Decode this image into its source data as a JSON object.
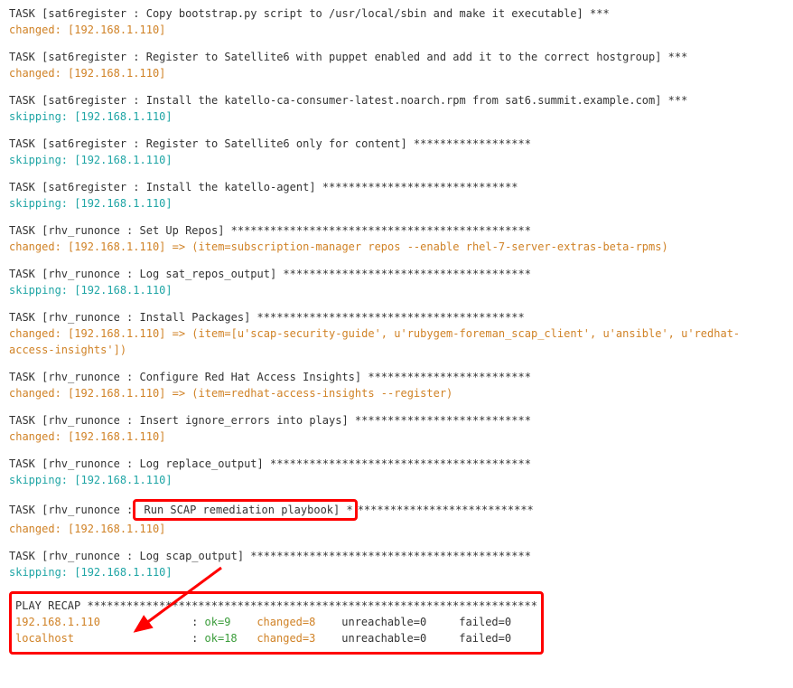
{
  "tasks": [
    {
      "header": "TASK [sat6register : Copy bootstrap.py script to /usr/local/sbin and make it executable] ***",
      "status_class": "changed",
      "status_text": "changed: [192.168.1.110]"
    },
    {
      "header": "TASK [sat6register : Register to Satellite6 with puppet enabled and add it to the correct hostgroup] ***",
      "status_class": "changed",
      "status_text": "changed: [192.168.1.110]"
    },
    {
      "header": "TASK [sat6register : Install the katello-ca-consumer-latest.noarch.rpm from sat6.summit.example.com] ***",
      "status_class": "skipping",
      "status_text": "skipping: [192.168.1.110]"
    },
    {
      "header": "TASK [sat6register : Register to Satellite6 only for content] ******************",
      "status_class": "skipping",
      "status_text": "skipping: [192.168.1.110]"
    },
    {
      "header": "TASK [sat6register : Install the katello-agent] ******************************",
      "status_class": "skipping",
      "status_text": "skipping: [192.168.1.110]"
    },
    {
      "header": "TASK [rhv_runonce : Set Up Repos] **********************************************",
      "status_class": "changed",
      "status_text": "changed: [192.168.1.110] => (item=subscription-manager repos --enable rhel-7-server-extras-beta-rpms)"
    },
    {
      "header": "TASK [rhv_runonce : Log sat_repos_output] **************************************",
      "status_class": "skipping",
      "status_text": "skipping: [192.168.1.110]"
    },
    {
      "header": "TASK [rhv_runonce : Install Packages] *****************************************",
      "status_class": "changed",
      "status_text": "changed: [192.168.1.110] => (item=[u'scap-security-guide', u'rubygem-foreman_scap_client', u'ansible', u'redhat-access-insights'])"
    },
    {
      "header": "TASK [rhv_runonce : Configure Red Hat Access Insights] *************************",
      "status_class": "changed",
      "status_text": "changed: [192.168.1.110] => (item=redhat-access-insights --register)"
    },
    {
      "header": "TASK [rhv_runonce : Insert ignore_errors into plays] ***************************",
      "status_class": "changed",
      "status_text": "changed: [192.168.1.110]"
    },
    {
      "header": "TASK [rhv_runonce : Log replace_output] ****************************************",
      "status_class": "skipping",
      "status_text": "skipping: [192.168.1.110]"
    }
  ],
  "highlighted_task": {
    "header_pre": "TASK [rhv_runonce :",
    "header_boxed": " Run SCAP remediation playbook] *",
    "header_post": "***************************",
    "status_class": "changed",
    "status_text": "changed: [192.168.1.110]"
  },
  "after_task": {
    "header": "TASK [rhv_runonce : Log scap_output] *******************************************",
    "status_class": "skipping",
    "status_text": "skipping: [192.168.1.110]"
  },
  "recap": {
    "title": "PLAY RECAP *********************************************************************",
    "rows": [
      {
        "host": "192.168.1.110",
        "ok": "ok=9",
        "changed": "changed=8",
        "unreachable": "unreachable=0",
        "failed": "failed=0"
      },
      {
        "host": "localhost",
        "ok": "ok=18",
        "changed": "changed=3",
        "unreachable": "unreachable=0",
        "failed": "failed=0"
      }
    ],
    "colon": ": "
  }
}
